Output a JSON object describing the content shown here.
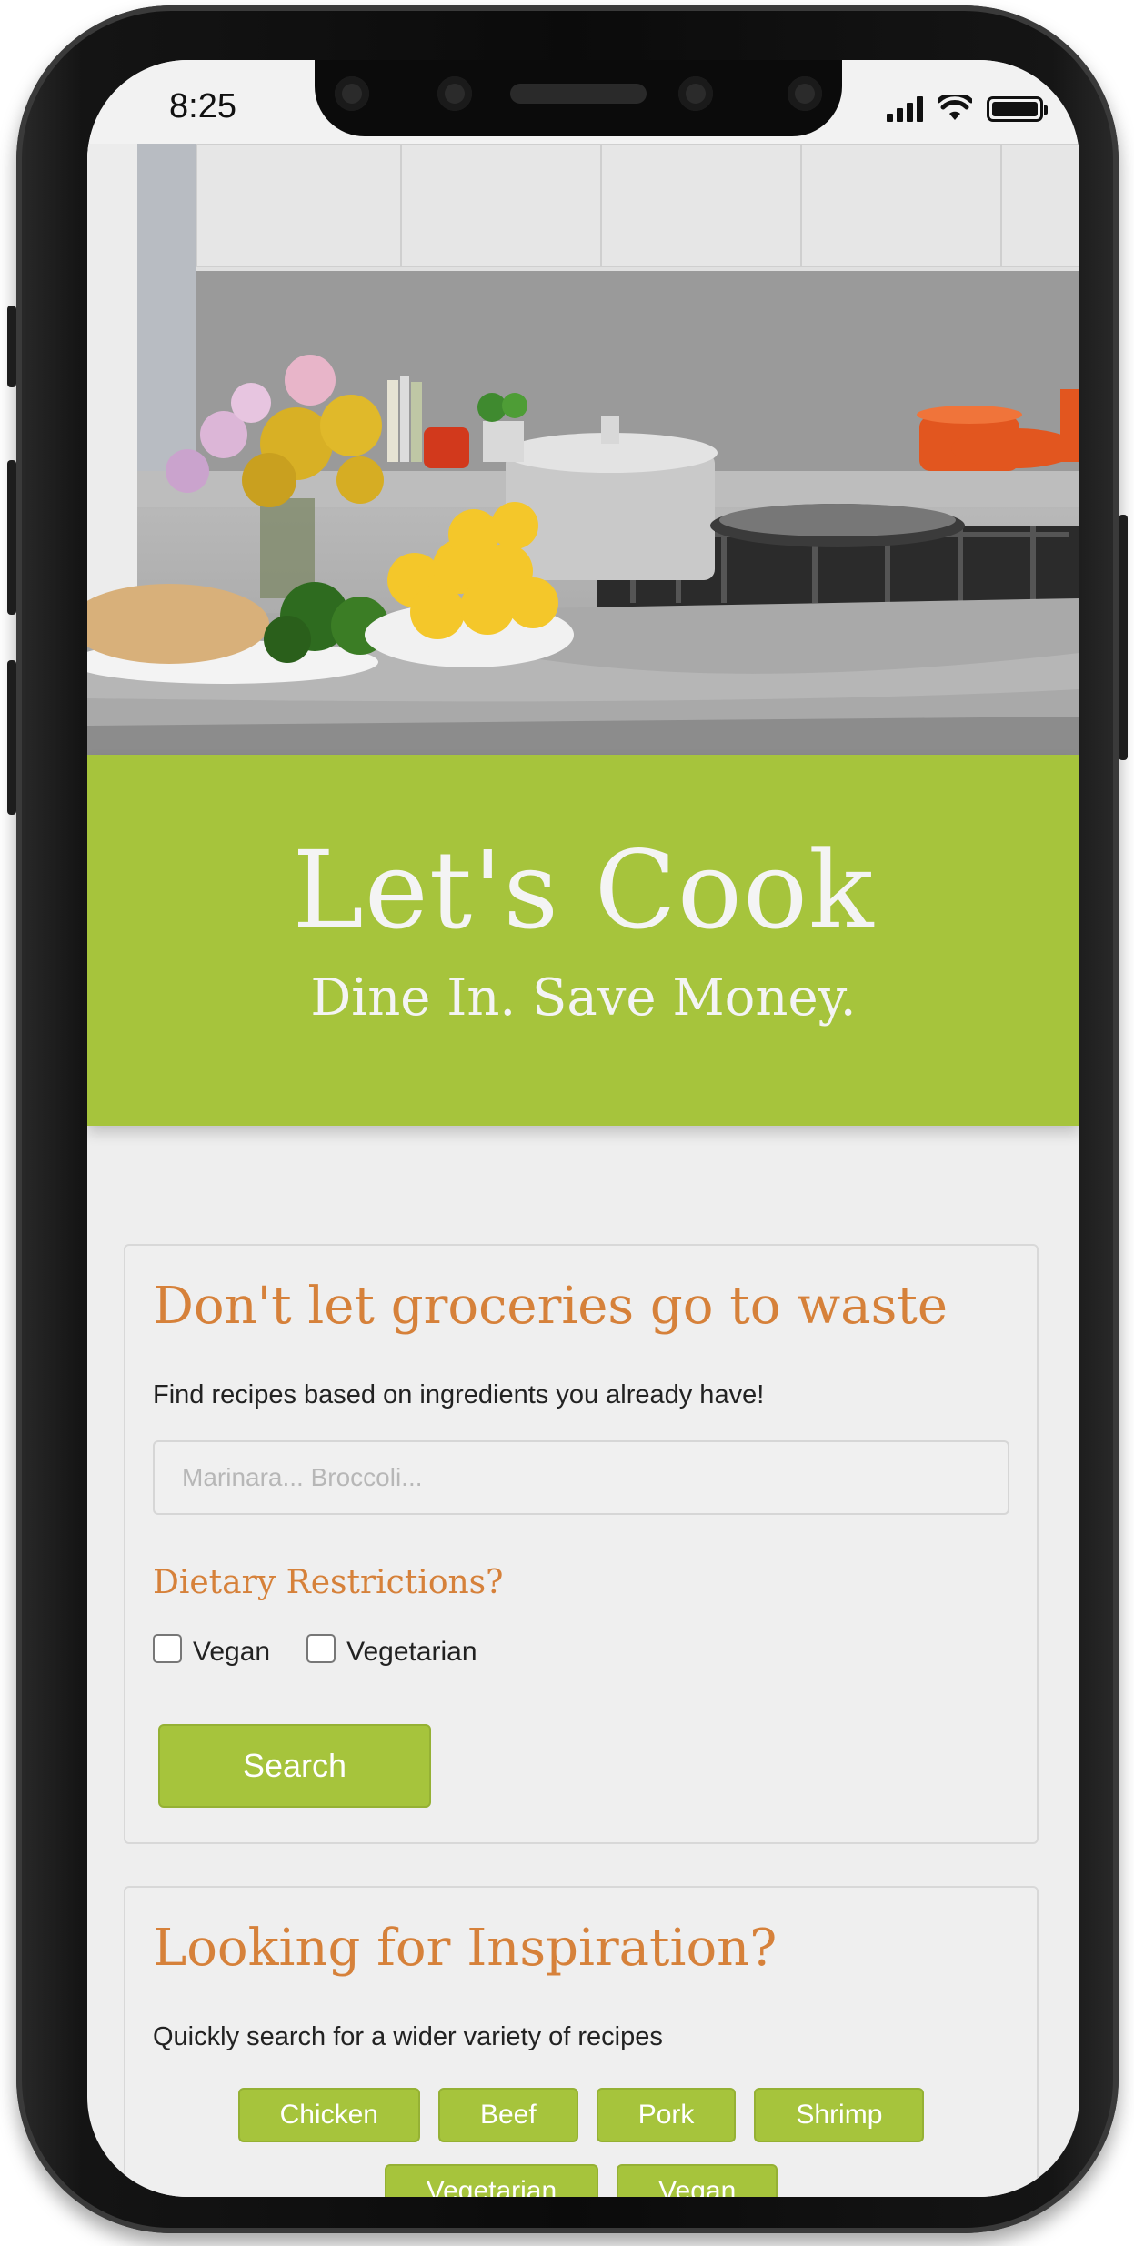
{
  "status_bar": {
    "time": "8:25"
  },
  "banner": {
    "title": "Let's Cook",
    "subtitle": "Dine In. Save Money."
  },
  "ingredients_card": {
    "title": "Don't let groceries go to waste",
    "description": "Find recipes based on ingredients you already have!",
    "search_placeholder": "Marinara... Broccoli...",
    "search_value": "",
    "diet_label": "Dietary Restrictions?",
    "options": [
      {
        "label": "Vegan",
        "checked": false
      },
      {
        "label": "Vegetarian",
        "checked": false
      }
    ],
    "search_button": "Search"
  },
  "inspiration_card": {
    "title": "Looking for Inspiration?",
    "description": "Quickly search for a wider variety of recipes",
    "chips": [
      "Chicken",
      "Beef",
      "Pork",
      "Shrimp",
      "Vegetarian",
      "Vegan"
    ]
  },
  "colors": {
    "accent_green": "#a6c43c",
    "heading_orange": "#d6813a",
    "page_background": "#eeeeee"
  }
}
